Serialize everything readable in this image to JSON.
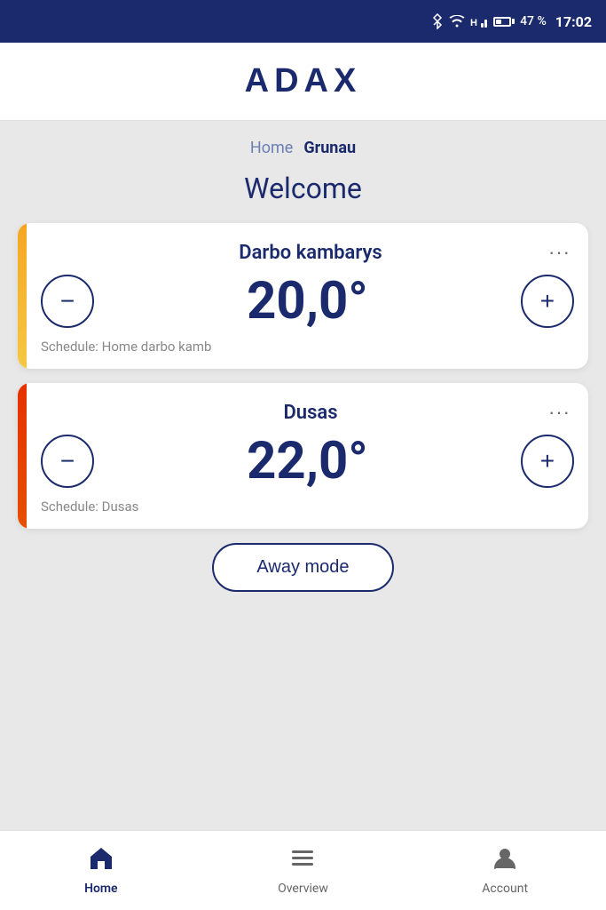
{
  "statusBar": {
    "battery": "47 %",
    "time": "17:02"
  },
  "header": {
    "logo": "ADAX"
  },
  "breadcrumb": {
    "parent": "Home",
    "current": "Grunau"
  },
  "welcome": {
    "title": "Welcome"
  },
  "rooms": [
    {
      "id": "darbo-kambarys",
      "name": "Darbo kambarys",
      "temperature": "20,0°",
      "schedule": "Schedule: Home darbo kamb",
      "indicatorColor": "yellow"
    },
    {
      "id": "dusas",
      "name": "Dusas",
      "temperature": "22,0°",
      "schedule": "Schedule: Dusas",
      "indicatorColor": "red"
    }
  ],
  "awayMode": {
    "label": "Away mode"
  },
  "bottomNav": {
    "items": [
      {
        "id": "home",
        "label": "Home",
        "active": true
      },
      {
        "id": "overview",
        "label": "Overview",
        "active": false
      },
      {
        "id": "account",
        "label": "Account",
        "active": false
      }
    ]
  },
  "controls": {
    "decrease": "−",
    "increase": "+"
  }
}
